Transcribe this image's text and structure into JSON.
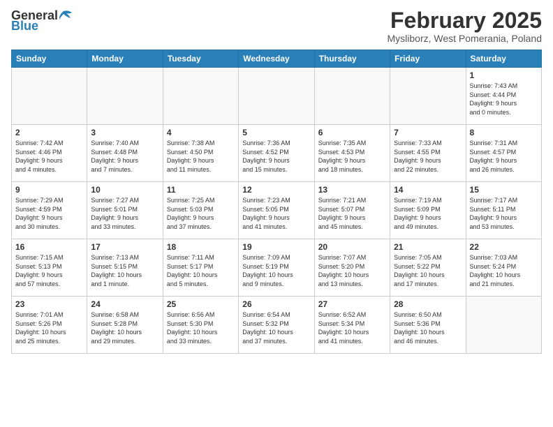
{
  "header": {
    "logo_general": "General",
    "logo_blue": "Blue",
    "month": "February 2025",
    "location": "Mysliborz, West Pomerania, Poland"
  },
  "weekdays": [
    "Sunday",
    "Monday",
    "Tuesday",
    "Wednesday",
    "Thursday",
    "Friday",
    "Saturday"
  ],
  "weeks": [
    [
      {
        "day": "",
        "info": ""
      },
      {
        "day": "",
        "info": ""
      },
      {
        "day": "",
        "info": ""
      },
      {
        "day": "",
        "info": ""
      },
      {
        "day": "",
        "info": ""
      },
      {
        "day": "",
        "info": ""
      },
      {
        "day": "1",
        "info": "Sunrise: 7:43 AM\nSunset: 4:44 PM\nDaylight: 9 hours\nand 0 minutes."
      }
    ],
    [
      {
        "day": "2",
        "info": "Sunrise: 7:42 AM\nSunset: 4:46 PM\nDaylight: 9 hours\nand 4 minutes."
      },
      {
        "day": "3",
        "info": "Sunrise: 7:40 AM\nSunset: 4:48 PM\nDaylight: 9 hours\nand 7 minutes."
      },
      {
        "day": "4",
        "info": "Sunrise: 7:38 AM\nSunset: 4:50 PM\nDaylight: 9 hours\nand 11 minutes."
      },
      {
        "day": "5",
        "info": "Sunrise: 7:36 AM\nSunset: 4:52 PM\nDaylight: 9 hours\nand 15 minutes."
      },
      {
        "day": "6",
        "info": "Sunrise: 7:35 AM\nSunset: 4:53 PM\nDaylight: 9 hours\nand 18 minutes."
      },
      {
        "day": "7",
        "info": "Sunrise: 7:33 AM\nSunset: 4:55 PM\nDaylight: 9 hours\nand 22 minutes."
      },
      {
        "day": "8",
        "info": "Sunrise: 7:31 AM\nSunset: 4:57 PM\nDaylight: 9 hours\nand 26 minutes."
      }
    ],
    [
      {
        "day": "9",
        "info": "Sunrise: 7:29 AM\nSunset: 4:59 PM\nDaylight: 9 hours\nand 30 minutes."
      },
      {
        "day": "10",
        "info": "Sunrise: 7:27 AM\nSunset: 5:01 PM\nDaylight: 9 hours\nand 33 minutes."
      },
      {
        "day": "11",
        "info": "Sunrise: 7:25 AM\nSunset: 5:03 PM\nDaylight: 9 hours\nand 37 minutes."
      },
      {
        "day": "12",
        "info": "Sunrise: 7:23 AM\nSunset: 5:05 PM\nDaylight: 9 hours\nand 41 minutes."
      },
      {
        "day": "13",
        "info": "Sunrise: 7:21 AM\nSunset: 5:07 PM\nDaylight: 9 hours\nand 45 minutes."
      },
      {
        "day": "14",
        "info": "Sunrise: 7:19 AM\nSunset: 5:09 PM\nDaylight: 9 hours\nand 49 minutes."
      },
      {
        "day": "15",
        "info": "Sunrise: 7:17 AM\nSunset: 5:11 PM\nDaylight: 9 hours\nand 53 minutes."
      }
    ],
    [
      {
        "day": "16",
        "info": "Sunrise: 7:15 AM\nSunset: 5:13 PM\nDaylight: 9 hours\nand 57 minutes."
      },
      {
        "day": "17",
        "info": "Sunrise: 7:13 AM\nSunset: 5:15 PM\nDaylight: 10 hours\nand 1 minute."
      },
      {
        "day": "18",
        "info": "Sunrise: 7:11 AM\nSunset: 5:17 PM\nDaylight: 10 hours\nand 5 minutes."
      },
      {
        "day": "19",
        "info": "Sunrise: 7:09 AM\nSunset: 5:19 PM\nDaylight: 10 hours\nand 9 minutes."
      },
      {
        "day": "20",
        "info": "Sunrise: 7:07 AM\nSunset: 5:20 PM\nDaylight: 10 hours\nand 13 minutes."
      },
      {
        "day": "21",
        "info": "Sunrise: 7:05 AM\nSunset: 5:22 PM\nDaylight: 10 hours\nand 17 minutes."
      },
      {
        "day": "22",
        "info": "Sunrise: 7:03 AM\nSunset: 5:24 PM\nDaylight: 10 hours\nand 21 minutes."
      }
    ],
    [
      {
        "day": "23",
        "info": "Sunrise: 7:01 AM\nSunset: 5:26 PM\nDaylight: 10 hours\nand 25 minutes."
      },
      {
        "day": "24",
        "info": "Sunrise: 6:58 AM\nSunset: 5:28 PM\nDaylight: 10 hours\nand 29 minutes."
      },
      {
        "day": "25",
        "info": "Sunrise: 6:56 AM\nSunset: 5:30 PM\nDaylight: 10 hours\nand 33 minutes."
      },
      {
        "day": "26",
        "info": "Sunrise: 6:54 AM\nSunset: 5:32 PM\nDaylight: 10 hours\nand 37 minutes."
      },
      {
        "day": "27",
        "info": "Sunrise: 6:52 AM\nSunset: 5:34 PM\nDaylight: 10 hours\nand 41 minutes."
      },
      {
        "day": "28",
        "info": "Sunrise: 6:50 AM\nSunset: 5:36 PM\nDaylight: 10 hours\nand 46 minutes."
      },
      {
        "day": "",
        "info": ""
      }
    ]
  ]
}
